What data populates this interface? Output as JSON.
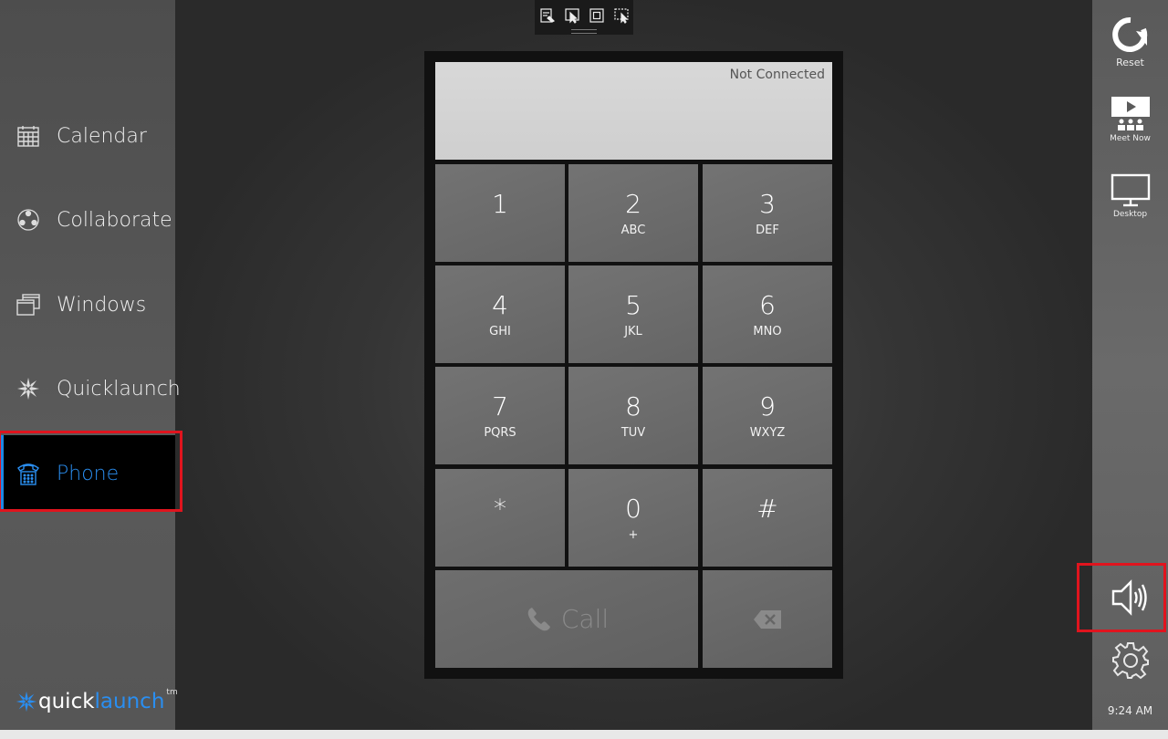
{
  "sidebar": {
    "items": [
      {
        "label": "Calendar",
        "icon": "calendar-icon"
      },
      {
        "label": "Collaborate",
        "icon": "collaborate-icon"
      },
      {
        "label": "Windows",
        "icon": "windows-icon"
      },
      {
        "label": "Quicklaunch",
        "icon": "quicklaunch-icon"
      },
      {
        "label": "Phone",
        "icon": "phone-icon",
        "active": true
      }
    ],
    "logo": {
      "part1": "quick",
      "part2": "launch",
      "tm": "tm"
    }
  },
  "toolbar": {
    "icons": [
      "annotate-icon",
      "pointer-icon",
      "fullscreen-icon",
      "screen-select-icon"
    ]
  },
  "phone": {
    "status": "Not Connected",
    "keys": [
      {
        "digit": "1",
        "letters": ""
      },
      {
        "digit": "2",
        "letters": "ABC"
      },
      {
        "digit": "3",
        "letters": "DEF"
      },
      {
        "digit": "4",
        "letters": "GHI"
      },
      {
        "digit": "5",
        "letters": "JKL"
      },
      {
        "digit": "6",
        "letters": "MNO"
      },
      {
        "digit": "7",
        "letters": "PQRS"
      },
      {
        "digit": "8",
        "letters": "TUV"
      },
      {
        "digit": "9",
        "letters": "WXYZ"
      },
      {
        "digit": "*",
        "letters": ""
      },
      {
        "digit": "0",
        "letters": "+"
      },
      {
        "digit": "#",
        "letters": ""
      }
    ],
    "call_label": "Call"
  },
  "rightbar": {
    "reset": "Reset",
    "meet_now": "Meet Now",
    "desktop": "Desktop",
    "time": "9:24 AM"
  },
  "colors": {
    "accent": "#2a8ef0",
    "highlight": "#e0141e"
  }
}
